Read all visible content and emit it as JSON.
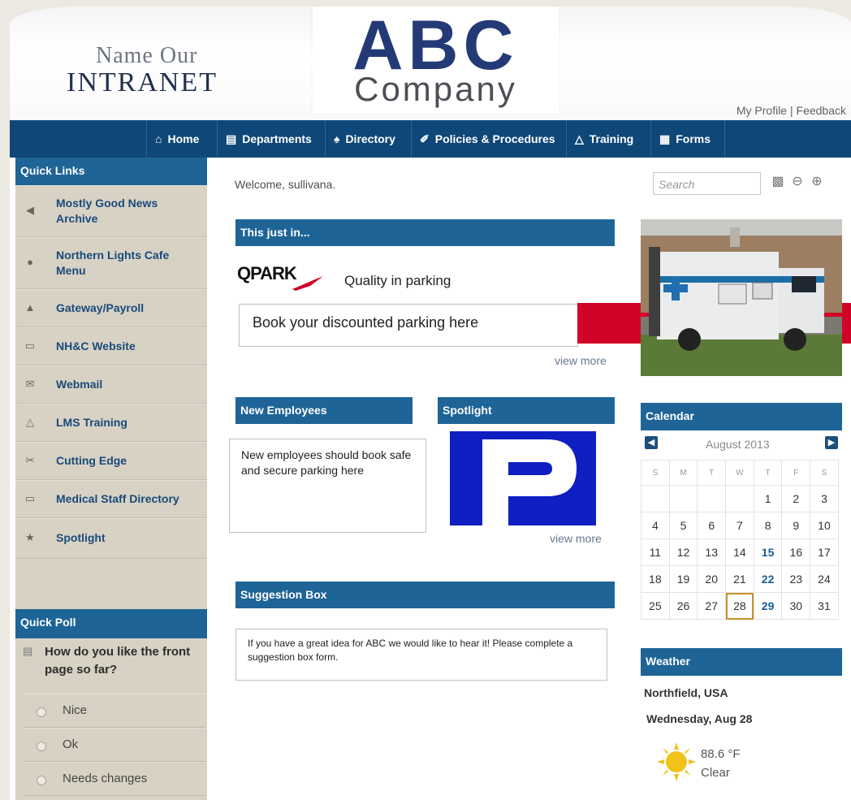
{
  "header": {
    "subtitle": "Name Our",
    "title": "INTRANET",
    "logo_main": "ABC",
    "logo_sub": "Company",
    "profile_link": "My Profile",
    "separator": " | ",
    "feedback_link": "Feedback"
  },
  "nav": {
    "items": [
      {
        "label": "Home",
        "icon": "home-icon"
      },
      {
        "label": "Departments",
        "icon": "building-icon"
      },
      {
        "label": "Directory",
        "icon": "people-icon"
      },
      {
        "label": "Policies & Procedures",
        "icon": "document-icon"
      },
      {
        "label": "Training",
        "icon": "graduation-cap-icon"
      },
      {
        "label": "Forms",
        "icon": "form-icon"
      }
    ]
  },
  "sidebar": {
    "quick_links_title": "Quick Links",
    "links": [
      {
        "label": "Mostly Good News Archive",
        "icon": "megaphone-icon"
      },
      {
        "label": "Northern Lights Cafe Menu",
        "icon": "cafe-icon"
      },
      {
        "label": "Gateway/Payroll",
        "icon": "payroll-icon"
      },
      {
        "label": "NH&C Website",
        "icon": "monitor-icon"
      },
      {
        "label": "Webmail",
        "icon": "mail-icon"
      },
      {
        "label": "LMS Training",
        "icon": "graduation-cap-icon"
      },
      {
        "label": "Cutting Edge",
        "icon": "scissors-icon"
      },
      {
        "label": "Medical Staff Directory",
        "icon": "monitor-icon"
      },
      {
        "label": "Spotlight",
        "icon": "spotlight-icon"
      }
    ],
    "poll_title": "Quick Poll",
    "poll_question": "How do you like the front page so far?",
    "poll_options": [
      "Nice",
      "Ok",
      "Needs changes"
    ]
  },
  "main": {
    "welcome": "Welcome, sullivana.",
    "this_just_in": {
      "title": "This just in...",
      "brand": "QPARK",
      "tagline": "Quality in parking",
      "box_text": "Book your discounted parking here",
      "view_more": "view more"
    },
    "new_employees": {
      "title": "New Employees",
      "text": "New employees should book safe and secure parking here"
    },
    "spotlight": {
      "title": "Spotlight",
      "image_letter": "P",
      "view_more": "view more"
    },
    "suggestion": {
      "title": "Suggestion Box",
      "text": "If you have a great idea for ABC we would like to hear it! Please complete a suggestion box form."
    }
  },
  "right": {
    "search_placeholder": "Search",
    "calendar": {
      "title": "Calendar",
      "month": "August 2013",
      "days": [
        "S",
        "M",
        "T",
        "W",
        "T",
        "F",
        "S"
      ],
      "weeks": [
        [
          "",
          "",
          "",
          "",
          "1",
          "2",
          "3"
        ],
        [
          "4",
          "5",
          "6",
          "7",
          "8",
          "9",
          "10"
        ],
        [
          "11",
          "12",
          "13",
          "14",
          "15",
          "16",
          "17"
        ],
        [
          "18",
          "19",
          "20",
          "21",
          "22",
          "23",
          "24"
        ],
        [
          "25",
          "26",
          "27",
          "28",
          "29",
          "30",
          "31"
        ]
      ],
      "highlighted": [
        "15",
        "22",
        "29"
      ],
      "today": "28"
    },
    "weather": {
      "title": "Weather",
      "location": "Northfield, USA",
      "date": "Wednesday, Aug 28",
      "temp": "88.6 °F",
      "condition": "Clear"
    }
  },
  "colors": {
    "nav_bg": "#0f4878",
    "section_head": "#1e6496",
    "sidebar_bg": "#d8d2c4",
    "accent_red": "#d10427",
    "spotlight_blue": "#0f1fc2"
  }
}
